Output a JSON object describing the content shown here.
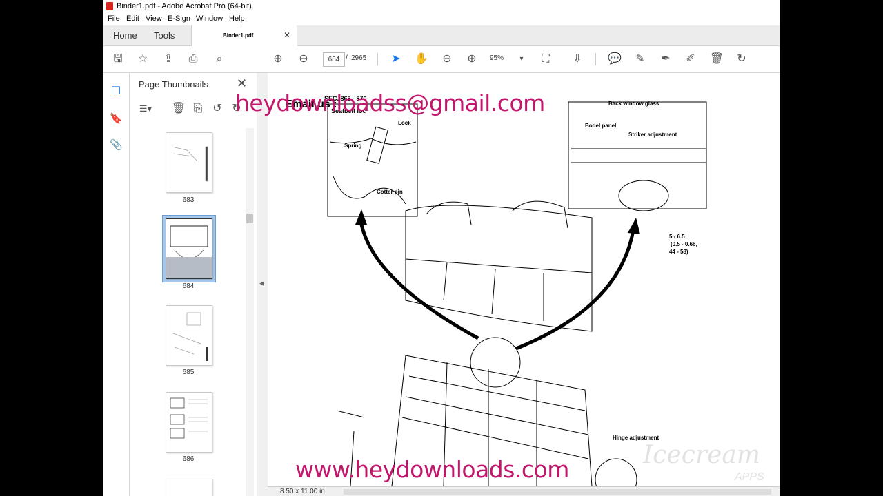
{
  "window": {
    "title": "Binder1.pdf - Adobe Acrobat Pro (64-bit)"
  },
  "menu": [
    "File",
    "Edit",
    "View",
    "E-Sign",
    "Window",
    "Help"
  ],
  "tabs": {
    "home": "Home",
    "tools": "Tools",
    "doc": "Binder1.pdf",
    "close": "✕"
  },
  "toolbar": {
    "page_current": "684",
    "page_sep": "/",
    "page_total": "2965",
    "zoom": "95%"
  },
  "thumbnails": {
    "title": "Page Thumbnails",
    "close": "✕",
    "pages": [
      {
        "num": "683"
      },
      {
        "num": "684"
      },
      {
        "num": "685"
      },
      {
        "num": "686"
      }
    ]
  },
  "document": {
    "email_label": "Email us :",
    "section_code": "SEC. 868 - 870",
    "seatbelt": "Seatbelt loc",
    "lock": "Lock",
    "spring": "Spring",
    "cotter": "Cotter pin",
    "back_window": "Back window glass",
    "body_panel": "Bodel panel",
    "striker": "Striker adjustment",
    "torque": "5 - 6.5",
    "torque2": "(0.5 - 0.66,",
    "torque3": "44 - 58)",
    "hinge": "Hinge adjustment"
  },
  "watermark": {
    "email": "heydownloadss@gmail.com",
    "site": "www.heydownloads.com",
    "brand": "Icecream",
    "brand2": "APPS"
  },
  "status": {
    "page_size": "8.50 x 11.00 in"
  },
  "colors": {
    "watermark": "#c2176c",
    "accent": "#d9261c"
  }
}
